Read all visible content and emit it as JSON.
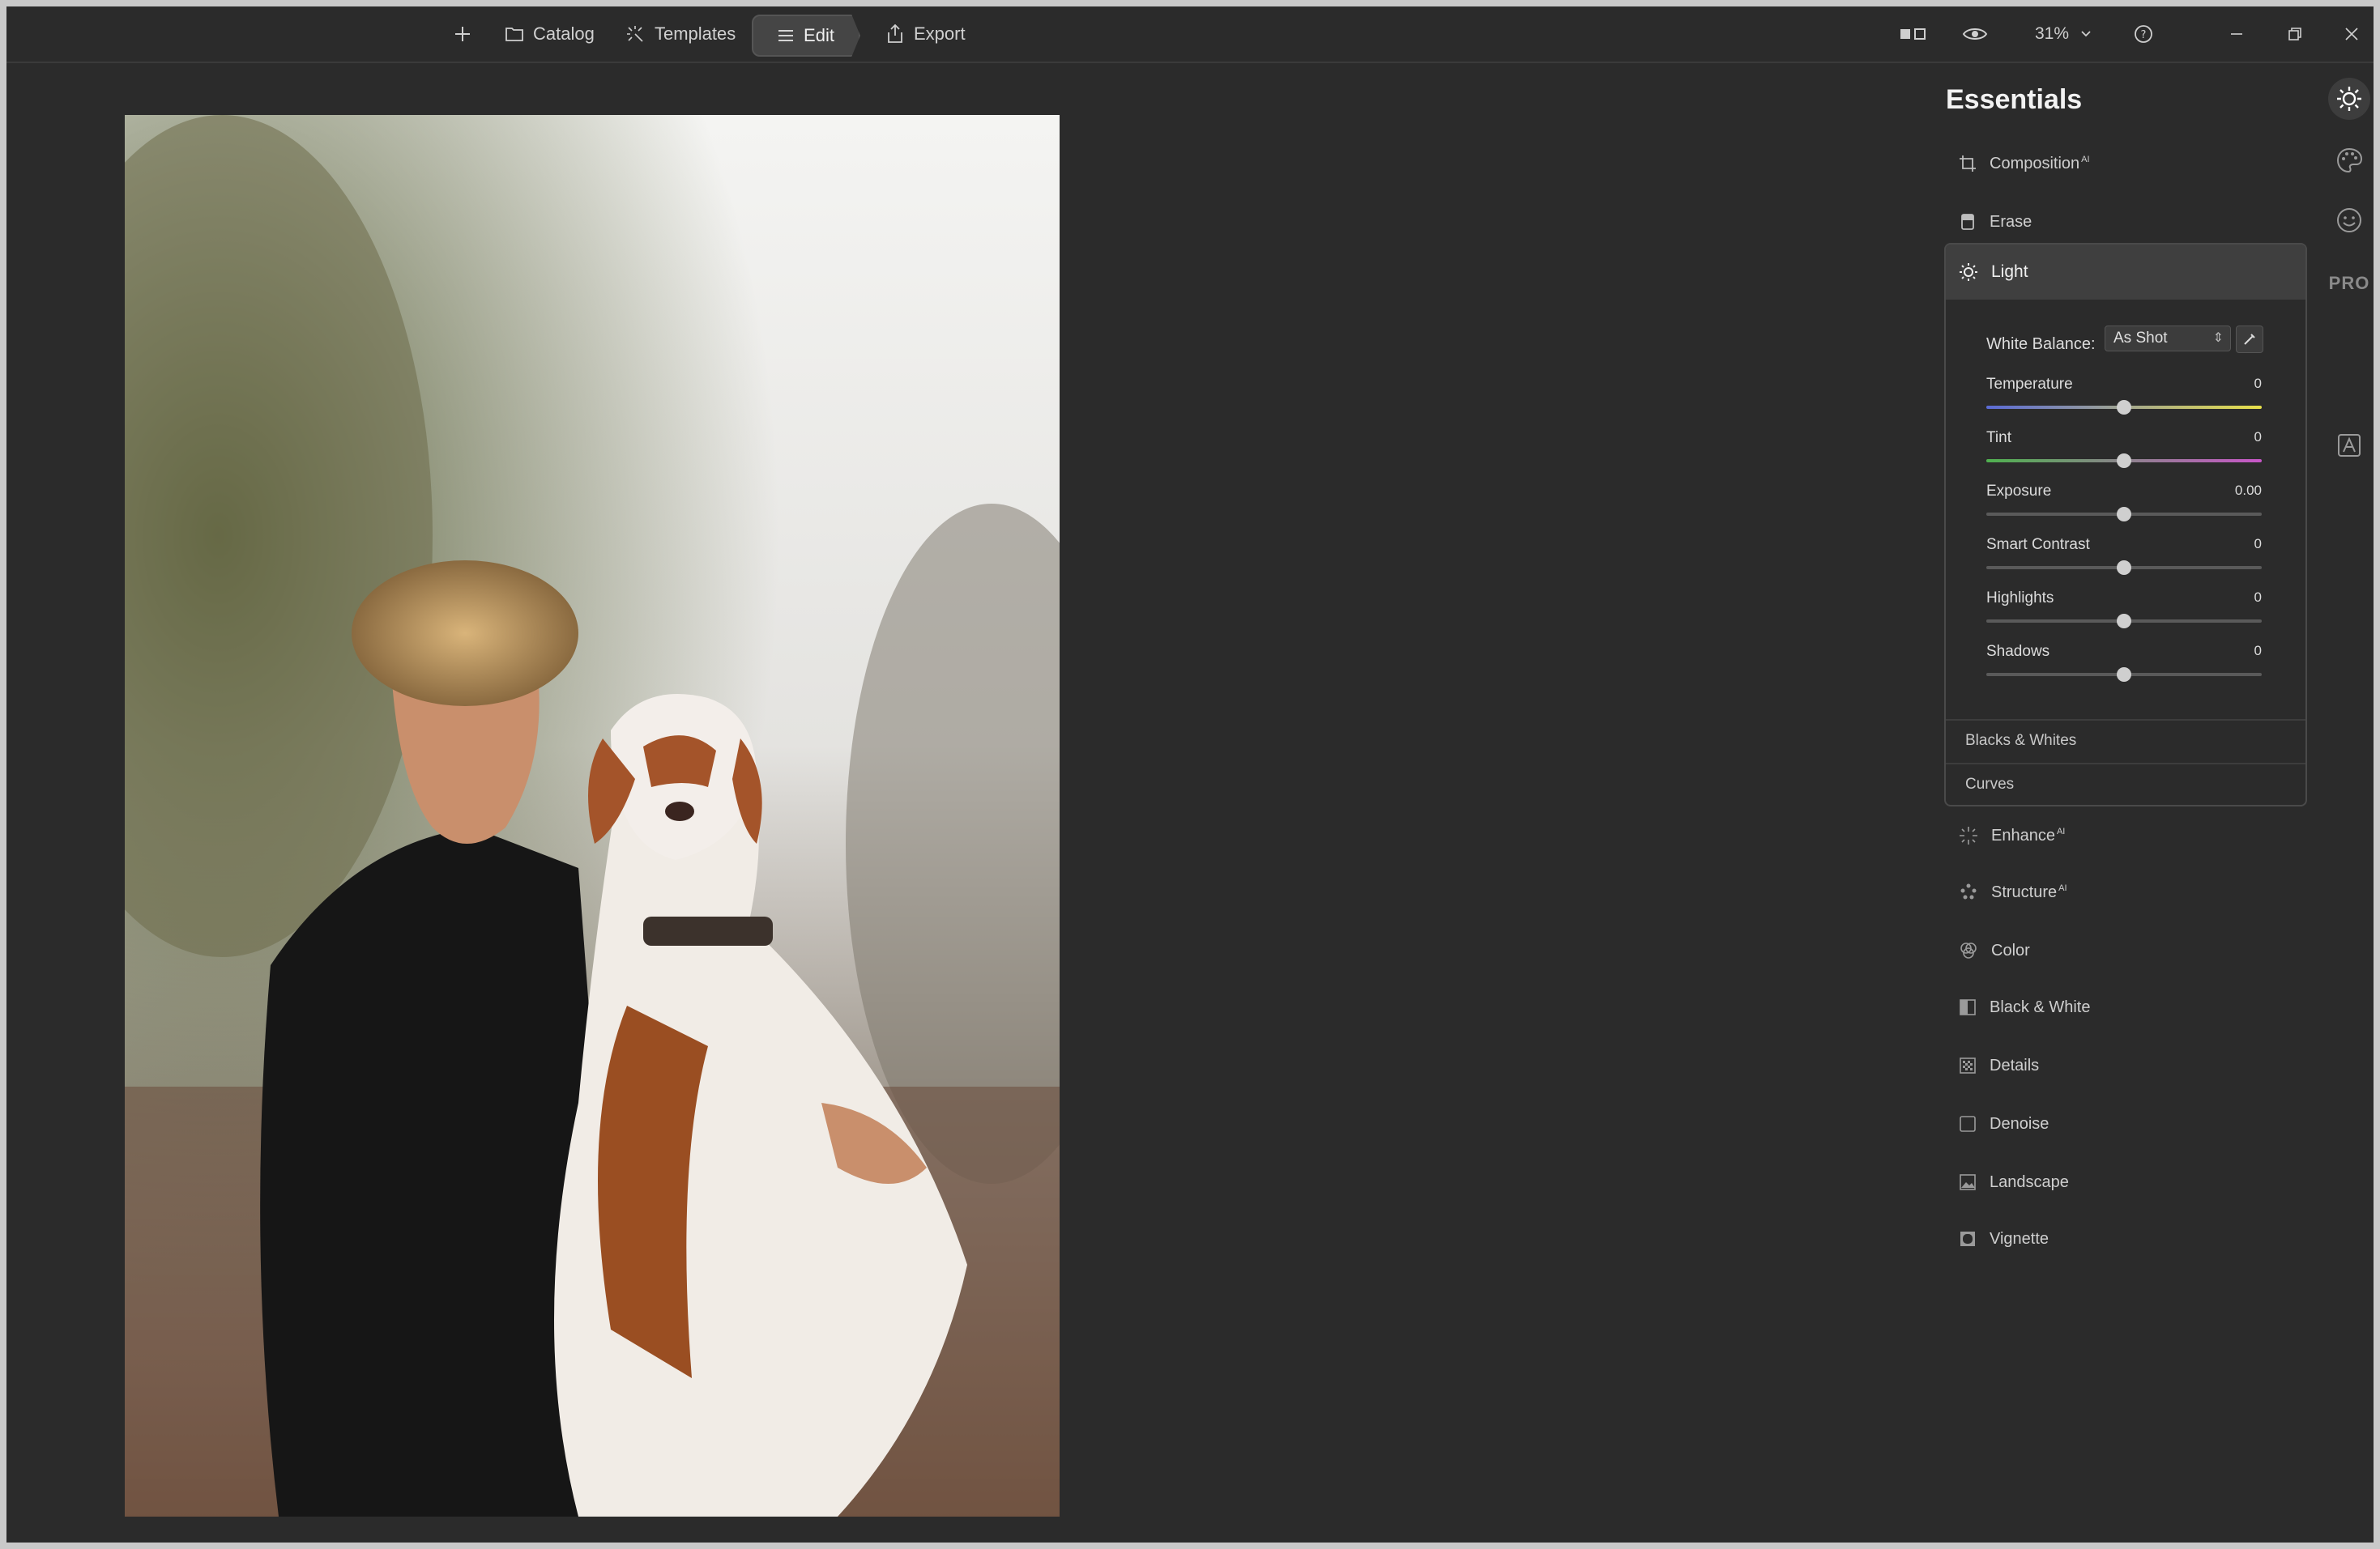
{
  "toolbar": {
    "add_icon": "plus-icon",
    "catalog_label": "Catalog",
    "templates_label": "Templates",
    "edit_label": "Edit",
    "export_label": "Export",
    "zoom_label": "31%",
    "compare_icon": "compare-icon",
    "preview_icon": "eye-icon",
    "help_icon": "help-icon",
    "minimize_icon": "minimize-icon",
    "restore_icon": "restore-icon",
    "close_icon": "close-icon"
  },
  "panel": {
    "title": "Essentials",
    "top_tools": [
      {
        "label": "Composition",
        "ai": "AI",
        "icon": "crop-icon"
      },
      {
        "label": "Erase",
        "icon": "eraser-icon"
      }
    ],
    "light": {
      "label": "Light",
      "white_balance_label": "White Balance:",
      "white_balance_value": "As Shot",
      "sliders": [
        {
          "label": "Temperature",
          "value": "0",
          "position": 0.5
        },
        {
          "label": "Tint",
          "value": "0",
          "position": 0.5
        },
        {
          "label": "Exposure",
          "value": "0.00",
          "position": 0.5
        },
        {
          "label": "Smart Contrast",
          "value": "0",
          "position": 0.5
        },
        {
          "label": "Highlights",
          "value": "0",
          "position": 0.5
        },
        {
          "label": "Shadows",
          "value": "0",
          "position": 0.5
        }
      ],
      "sub_sections": [
        "Blacks & Whites",
        "Curves"
      ]
    },
    "bottom_tools": [
      {
        "label": "Enhance",
        "ai": "AI",
        "icon": "sparkle-icon"
      },
      {
        "label": "Structure",
        "ai": "AI",
        "icon": "structure-icon"
      },
      {
        "label": "Color",
        "icon": "color-icon"
      },
      {
        "label": "Black & White",
        "icon": "bw-icon"
      },
      {
        "label": "Details",
        "icon": "details-icon"
      },
      {
        "label": "Denoise",
        "icon": "denoise-icon"
      },
      {
        "label": "Landscape",
        "icon": "landscape-icon"
      },
      {
        "label": "Vignette",
        "icon": "vignette-icon"
      }
    ]
  },
  "side_strip": {
    "pro_label": "PRO",
    "icons": [
      "essentials-sun-icon",
      "creative-palette-icon",
      "portrait-face-icon",
      "professional-icon"
    ]
  },
  "colors": {
    "background": "#2b2b2b",
    "panel_active": "#3f3f3f",
    "temperature_gradient": [
      "#5b6bd6",
      "#e8e04a"
    ],
    "tint_gradient": [
      "#4fb14f",
      "#c856c8"
    ]
  }
}
